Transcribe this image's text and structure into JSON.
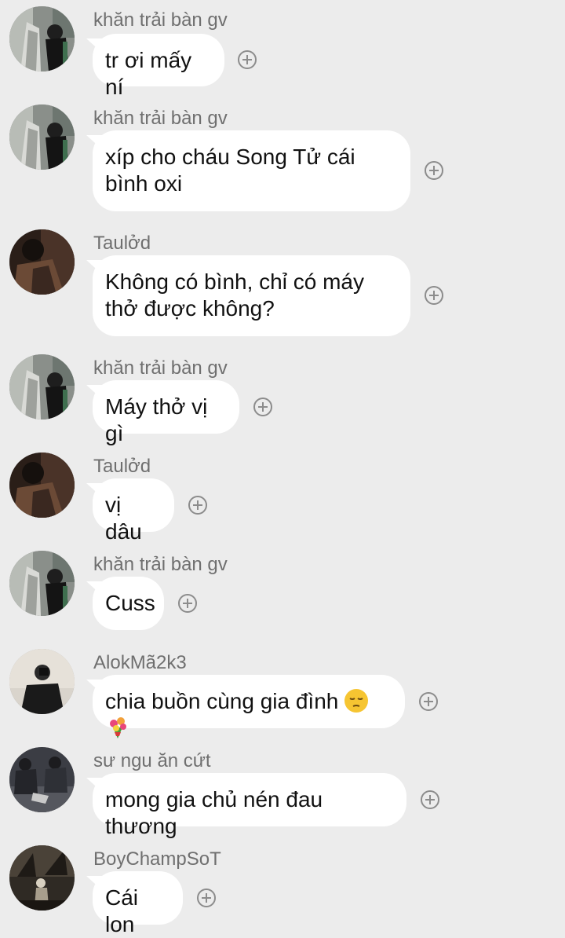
{
  "messages": [
    {
      "sender": "khăn trải bàn gv",
      "text": "tr ơi mấy ní",
      "avatar": "photo-person-wall-icon"
    },
    {
      "sender": "khăn trải bàn gv",
      "text": "xíp cho cháu Song Tử cái bình oxi",
      "avatar": "photo-person-wall-icon"
    },
    {
      "sender": "Taulởd",
      "text": "Không có bình, chỉ có máy thở được không?",
      "avatar": "photo-person-dark-icon"
    },
    {
      "sender": "khăn trải bàn gv",
      "text": "Máy thở vị gì",
      "avatar": "photo-person-wall-icon"
    },
    {
      "sender": "Taulởd",
      "text": "vị dâu",
      "avatar": "photo-person-dark-icon"
    },
    {
      "sender": "khăn trải bàn gv",
      "text": "Cuss",
      "avatar": "photo-person-wall-icon"
    },
    {
      "sender": "AlokMã2k3",
      "text": "chia buồn cùng gia đình",
      "emojis": [
        "pensive-face-icon",
        "bouquet-icon"
      ],
      "avatar": "photo-mirror-selfie-icon"
    },
    {
      "sender": "sư ngu ăn cứt",
      "text": "mong gia chủ nén đau thương",
      "avatar": "photo-people-sitting-icon"
    },
    {
      "sender": "BoyChampSoT",
      "text": "Cái lon",
      "avatar": "photo-night-street-icon"
    }
  ],
  "colors": {
    "background": "#ececec",
    "bubble": "#ffffff",
    "sender_text": "#6f6f6f",
    "message_text": "#111111",
    "add_icon": "#8c8c8c"
  }
}
